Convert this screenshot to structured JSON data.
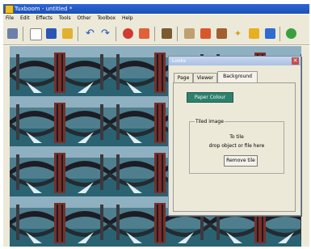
{
  "window": {
    "title": "Tuxboom - untitled *"
  },
  "menu": [
    "File",
    "Edit",
    "Effects",
    "Tools",
    "Other",
    "Toolbox",
    "Help"
  ],
  "toolbar_icons": [
    "settings-icon",
    "new-file-icon",
    "save-icon",
    "open-folder-icon",
    "undo-icon",
    "redo-icon",
    "ladybug-icon",
    "paint-icon",
    "clapperboard-icon",
    "text-icon",
    "stamp-icon",
    "magic-wand-icon",
    "sparkle-icon",
    "flag-icon",
    "window-icon",
    "go-icon"
  ],
  "looks": {
    "title": "Looks",
    "tabs": [
      "Page",
      "Viewer",
      "Background"
    ],
    "active_tab": "Background",
    "paper_colour_label": "Paper Colour",
    "tiled_group_label": "Tiled image",
    "tile_hint_line1": "To tile",
    "tile_hint_line2": "drop object or file here",
    "remove_tile_label": "Remove tile"
  },
  "colors": {
    "titlebar": "#1f55c4",
    "paper_button": "#2f7f6e",
    "dialog_bg": "#ece9d8"
  }
}
